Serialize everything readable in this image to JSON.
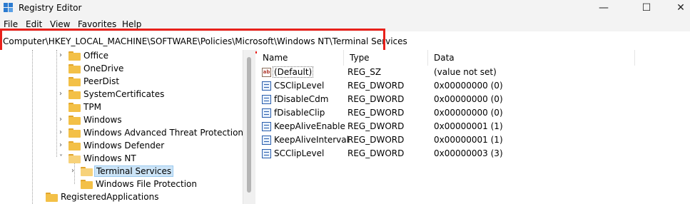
{
  "window": {
    "title": "Registry Editor",
    "minimize": "—",
    "maximize": "☐",
    "close": "✕"
  },
  "menu": [
    "File",
    "Edit",
    "View",
    "Favorites",
    "Help"
  ],
  "address": "Computer\\HKEY_LOCAL_MACHINE\\SOFTWARE\\Policies\\Microsoft\\Windows NT\\Terminal Services",
  "highlight_color": "#e8211b",
  "tree": [
    {
      "label": "Office",
      "chevron": "›"
    },
    {
      "label": "OneDrive",
      "chevron": ""
    },
    {
      "label": "PeerDist",
      "chevron": ""
    },
    {
      "label": "SystemCertificates",
      "chevron": "›"
    },
    {
      "label": "TPM",
      "chevron": ""
    },
    {
      "label": "Windows",
      "chevron": "›"
    },
    {
      "label": "Windows Advanced Threat Protection",
      "chevron": "›"
    },
    {
      "label": "Windows Defender",
      "chevron": "›"
    },
    {
      "label": "Windows NT",
      "chevron": "˅"
    },
    {
      "label": "Terminal Services",
      "chevron": "›",
      "selected": true
    },
    {
      "label": "Windows File Protection",
      "chevron": ""
    },
    {
      "label": "RegisteredApplications",
      "chevron": ""
    }
  ],
  "columns": {
    "name": "Name",
    "type": "Type",
    "data": "Data"
  },
  "values": [
    {
      "icon": "ab",
      "name": "(Default)",
      "type": "REG_SZ",
      "data": "(value not set)"
    },
    {
      "icon": "binary-value-icon",
      "name": "CSClipLevel",
      "type": "REG_DWORD",
      "data": "0x00000000 (0)"
    },
    {
      "icon": "binary-value-icon",
      "name": "fDisableCdm",
      "type": "REG_DWORD",
      "data": "0x00000000 (0)"
    },
    {
      "icon": "binary-value-icon",
      "name": "fDisableClip",
      "type": "REG_DWORD",
      "data": "0x00000000 (0)"
    },
    {
      "icon": "binary-value-icon",
      "name": "KeepAliveEnable",
      "type": "REG_DWORD",
      "data": "0x00000001 (1)"
    },
    {
      "icon": "binary-value-icon",
      "name": "KeepAliveInterval",
      "type": "REG_DWORD",
      "data": "0x00000001 (1)"
    },
    {
      "icon": "binary-value-icon",
      "name": "SCClipLevel",
      "type": "REG_DWORD",
      "data": "0x00000003 (3)"
    }
  ]
}
